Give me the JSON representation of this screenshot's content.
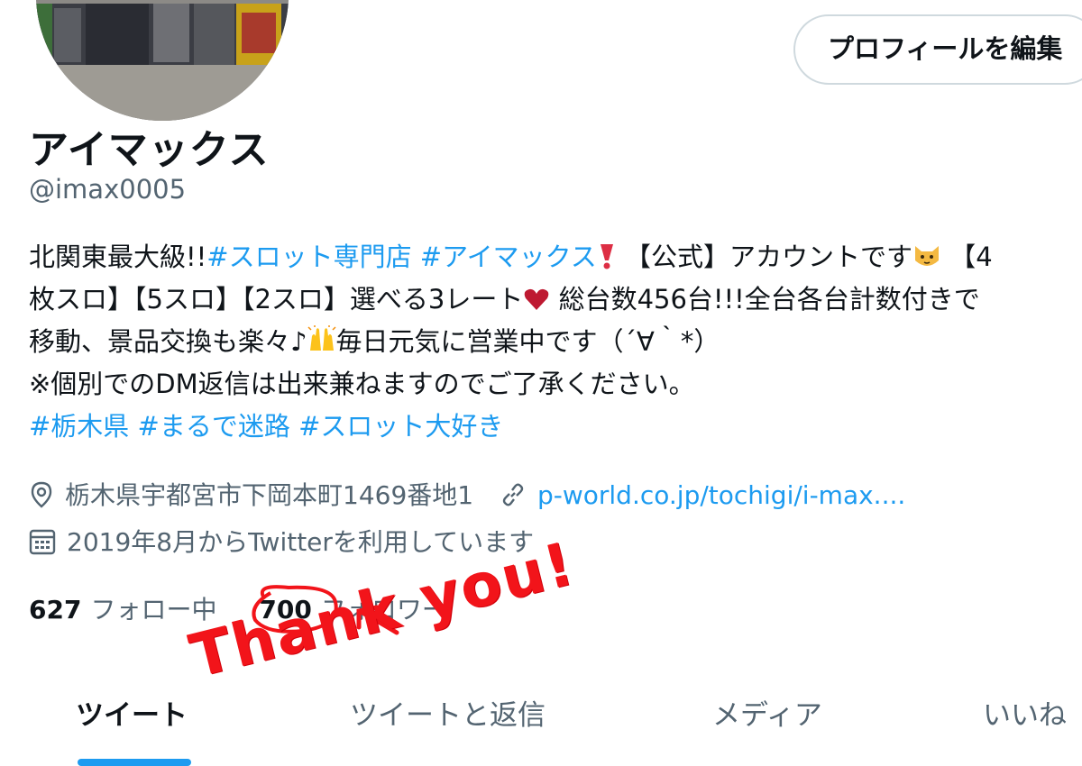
{
  "profile": {
    "edit_button_label": "プロフィールを編集",
    "display_name": "アイマックス",
    "handle": "@imax0005"
  },
  "bio": {
    "line1_a": "北関東最大級!!",
    "line1_tag1": "#スロット専門店",
    "line1_tag2": "#アイマックス",
    "line1_b": "【公式】アカウントです",
    "line1_c": "【4",
    "line2_a": "枚スロ】【5スロ】【2スロ】選べる3レート",
    "line2_b": "総台数456台!!!全台各台計数付きで",
    "line3_a": "移動、景品交換も楽々♪",
    "line3_b": "毎日元気に営業中です（´∀｀*）",
    "line4": "※個別でのDM返信は出来兼ねますのでご了承ください。",
    "tags": [
      "#栃木県",
      "#まるで迷路",
      "#スロット大好き"
    ]
  },
  "meta": {
    "location": "栃木県宇都宮市下岡本町1469番地1",
    "link": "p-world.co.jp/tochigi/i-max....",
    "joined": "2019年8月からTwitterを利用しています",
    "icons": [
      "location-pin-icon",
      "link-icon",
      "calendar-icon"
    ]
  },
  "stats": {
    "following_count": "627",
    "following_label": "フォロー中",
    "followers_count": "700",
    "followers_label": "フォロワー"
  },
  "annotation": {
    "text": "Thank you!",
    "color": "#f2141a"
  },
  "tabs": [
    {
      "label": "ツイート",
      "active": true
    },
    {
      "label": "ツイートと返信",
      "active": false
    },
    {
      "label": "メディア",
      "active": false
    },
    {
      "label": "いいね",
      "active": false
    }
  ],
  "colors": {
    "accent": "#1d9bf0",
    "text": "#0f1419",
    "secondary": "#536471"
  }
}
